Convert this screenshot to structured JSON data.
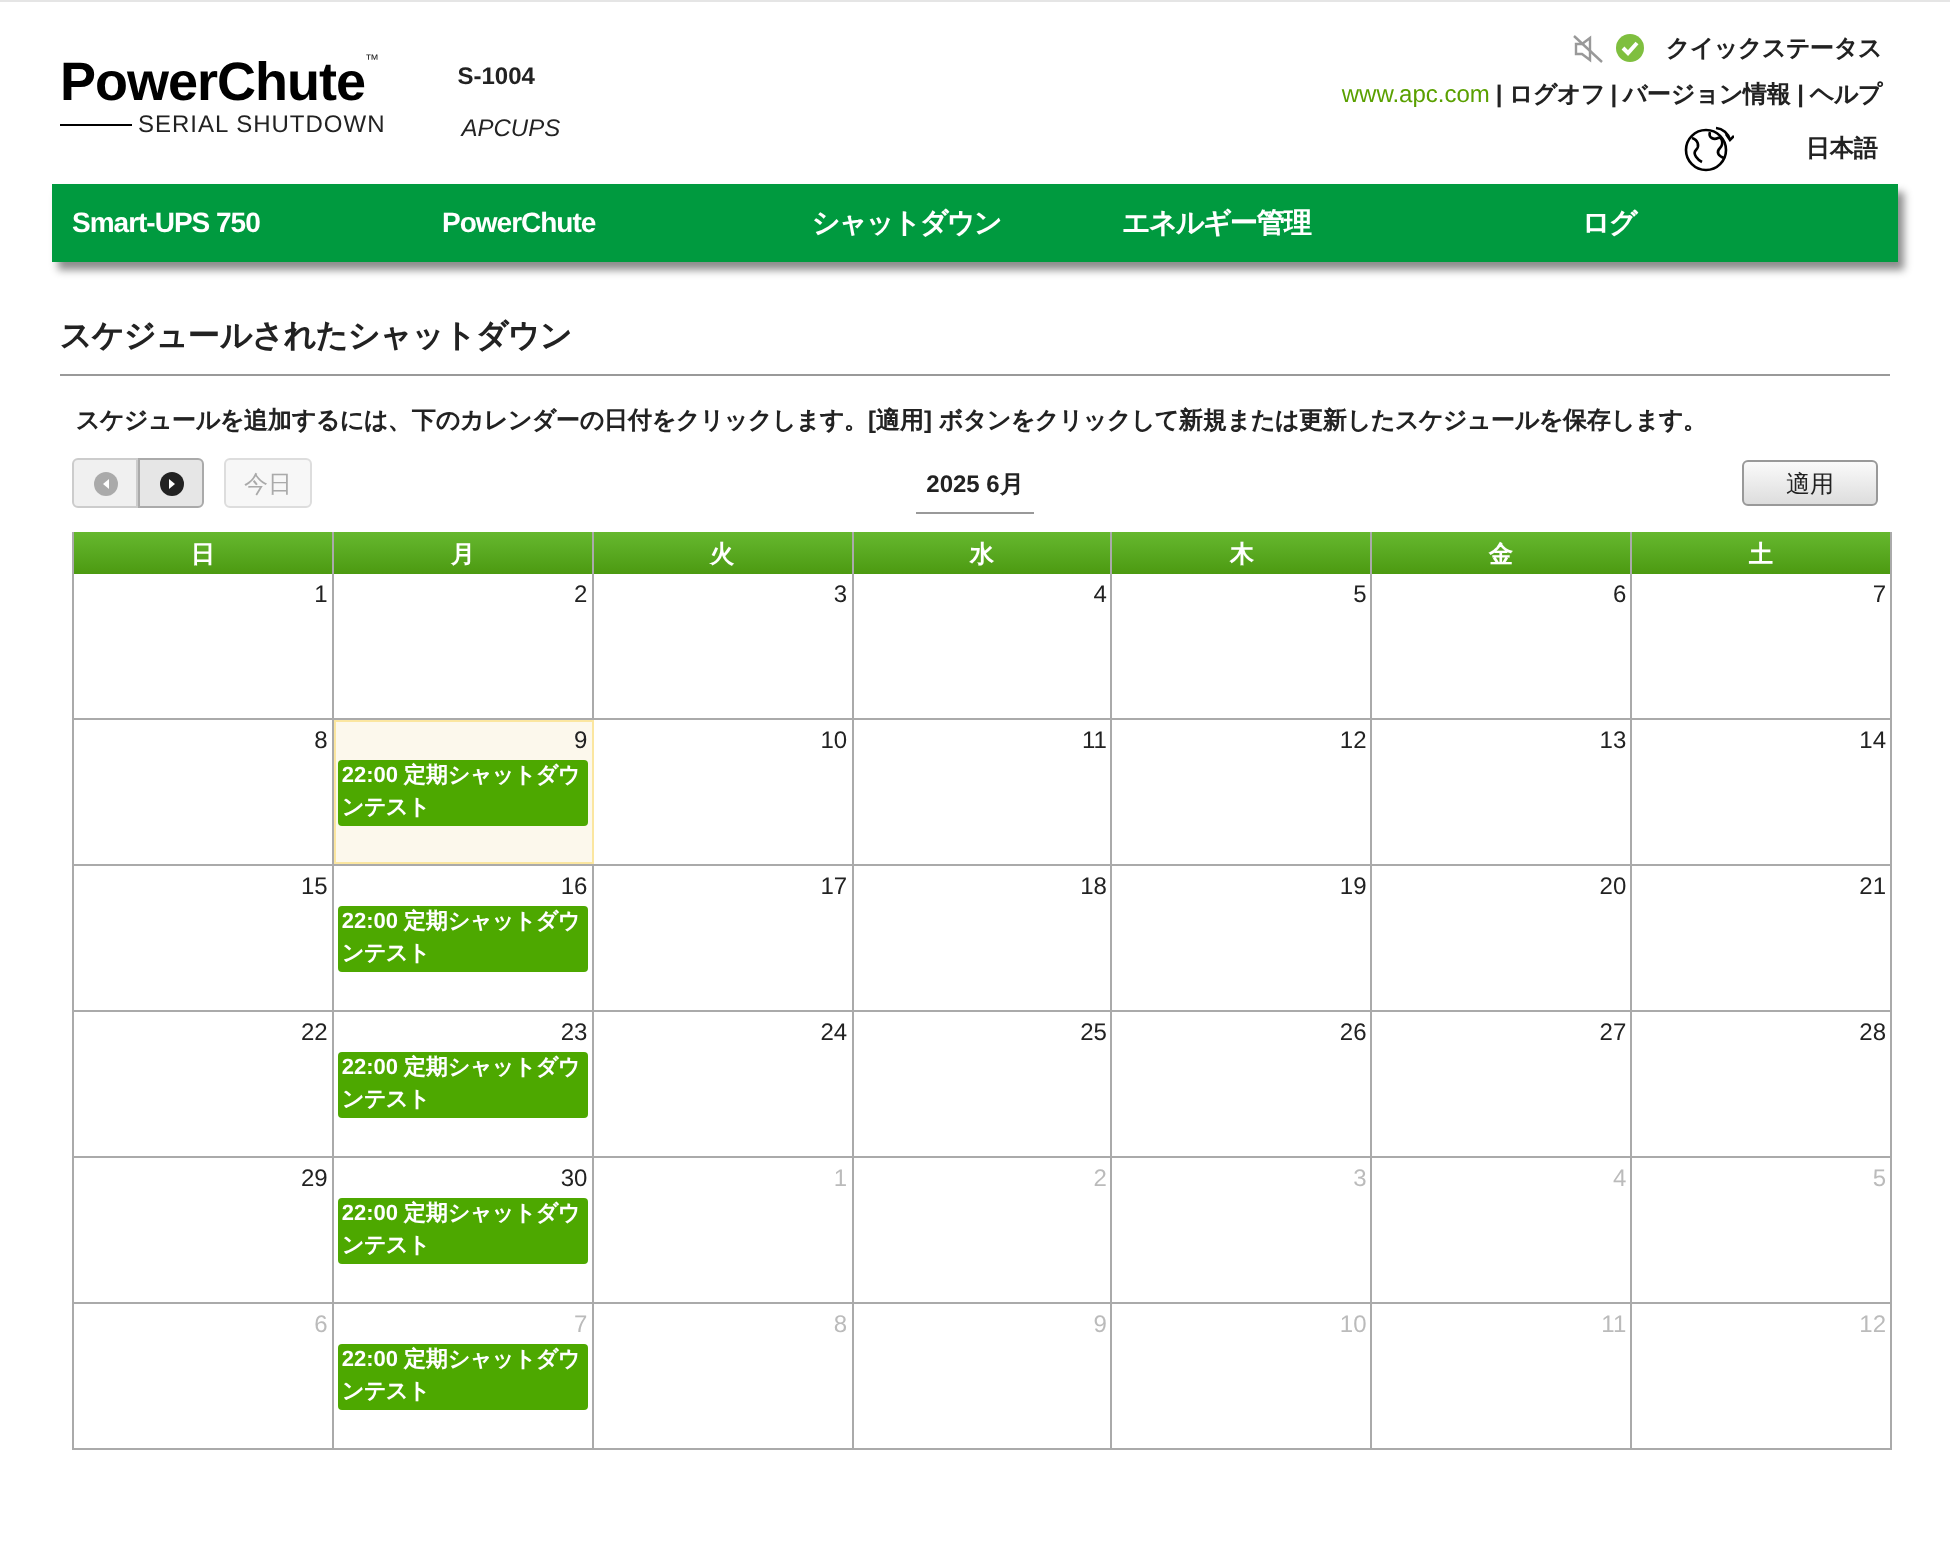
{
  "logo": {
    "name": "PowerChute",
    "trademark": "™",
    "subtitle": "SERIAL SHUTDOWN"
  },
  "device": {
    "model": "S-1004",
    "name": "APCUPS"
  },
  "header": {
    "quick_status": "クイックステータス",
    "links": [
      {
        "label": "www.apc.com",
        "kind": "external"
      },
      {
        "label": "|",
        "kind": "sep"
      },
      {
        "label": "ログオフ",
        "kind": "link"
      },
      {
        "label": "|",
        "kind": "sep"
      },
      {
        "label": "バージョン情報",
        "kind": "link"
      },
      {
        "label": "|",
        "kind": "sep"
      },
      {
        "label": "ヘルプ",
        "kind": "link"
      }
    ],
    "language": "日本語"
  },
  "nav": [
    {
      "label": "Smart-UPS 750"
    },
    {
      "label": "PowerChute"
    },
    {
      "label": "シャットダウン"
    },
    {
      "label": "エネルギー管理"
    },
    {
      "label": "ログ"
    }
  ],
  "page_title": "スケジュールされたシャットダウン",
  "instructions": "スケジュールを追加するには、下のカレンダーの日付をクリックします。[適用] ボタンをクリックして新規または更新したスケジュールを保存します。",
  "toolbar": {
    "prev_disabled": true,
    "today": "今日",
    "today_disabled": true,
    "month": "2025 6月",
    "apply": "適用"
  },
  "calendar": {
    "weekdays": [
      "日",
      "月",
      "火",
      "水",
      "木",
      "金",
      "土"
    ],
    "weeks": [
      [
        {
          "day": "1",
          "other_month": false,
          "today": false
        },
        {
          "day": "2",
          "other_month": false,
          "today": false
        },
        {
          "day": "3",
          "other_month": false,
          "today": false
        },
        {
          "day": "4",
          "other_month": false,
          "today": false
        },
        {
          "day": "5",
          "other_month": false,
          "today": false
        },
        {
          "day": "6",
          "other_month": false,
          "today": false
        },
        {
          "day": "7",
          "other_month": false,
          "today": false
        }
      ],
      [
        {
          "day": "8",
          "other_month": false,
          "today": false
        },
        {
          "day": "9",
          "other_month": false,
          "today": true,
          "events": [
            "22:00 定期シャットダウンテスト"
          ]
        },
        {
          "day": "10",
          "other_month": false,
          "today": false
        },
        {
          "day": "11",
          "other_month": false,
          "today": false
        },
        {
          "day": "12",
          "other_month": false,
          "today": false
        },
        {
          "day": "13",
          "other_month": false,
          "today": false
        },
        {
          "day": "14",
          "other_month": false,
          "today": false
        }
      ],
      [
        {
          "day": "15",
          "other_month": false,
          "today": false
        },
        {
          "day": "16",
          "other_month": false,
          "today": false,
          "events": [
            "22:00 定期シャットダウンテスト"
          ]
        },
        {
          "day": "17",
          "other_month": false,
          "today": false
        },
        {
          "day": "18",
          "other_month": false,
          "today": false
        },
        {
          "day": "19",
          "other_month": false,
          "today": false
        },
        {
          "day": "20",
          "other_month": false,
          "today": false
        },
        {
          "day": "21",
          "other_month": false,
          "today": false
        }
      ],
      [
        {
          "day": "22",
          "other_month": false,
          "today": false
        },
        {
          "day": "23",
          "other_month": false,
          "today": false,
          "events": [
            "22:00 定期シャットダウンテスト"
          ]
        },
        {
          "day": "24",
          "other_month": false,
          "today": false
        },
        {
          "day": "25",
          "other_month": false,
          "today": false
        },
        {
          "day": "26",
          "other_month": false,
          "today": false
        },
        {
          "day": "27",
          "other_month": false,
          "today": false
        },
        {
          "day": "28",
          "other_month": false,
          "today": false
        }
      ],
      [
        {
          "day": "29",
          "other_month": false,
          "today": false
        },
        {
          "day": "30",
          "other_month": false,
          "today": false,
          "events": [
            "22:00 定期シャットダウンテスト"
          ]
        },
        {
          "day": "1",
          "other_month": true,
          "today": false
        },
        {
          "day": "2",
          "other_month": true,
          "today": false
        },
        {
          "day": "3",
          "other_month": true,
          "today": false
        },
        {
          "day": "4",
          "other_month": true,
          "today": false
        },
        {
          "day": "5",
          "other_month": true,
          "today": false
        }
      ],
      [
        {
          "day": "6",
          "other_month": true,
          "today": false
        },
        {
          "day": "7",
          "other_month": true,
          "today": false,
          "events": [
            "22:00 定期シャットダウンテスト"
          ]
        },
        {
          "day": "8",
          "other_month": true,
          "today": false
        },
        {
          "day": "9",
          "other_month": true,
          "today": false
        },
        {
          "day": "10",
          "other_month": true,
          "today": false
        },
        {
          "day": "11",
          "other_month": true,
          "today": false
        },
        {
          "day": "12",
          "other_month": true,
          "today": false
        }
      ]
    ]
  }
}
